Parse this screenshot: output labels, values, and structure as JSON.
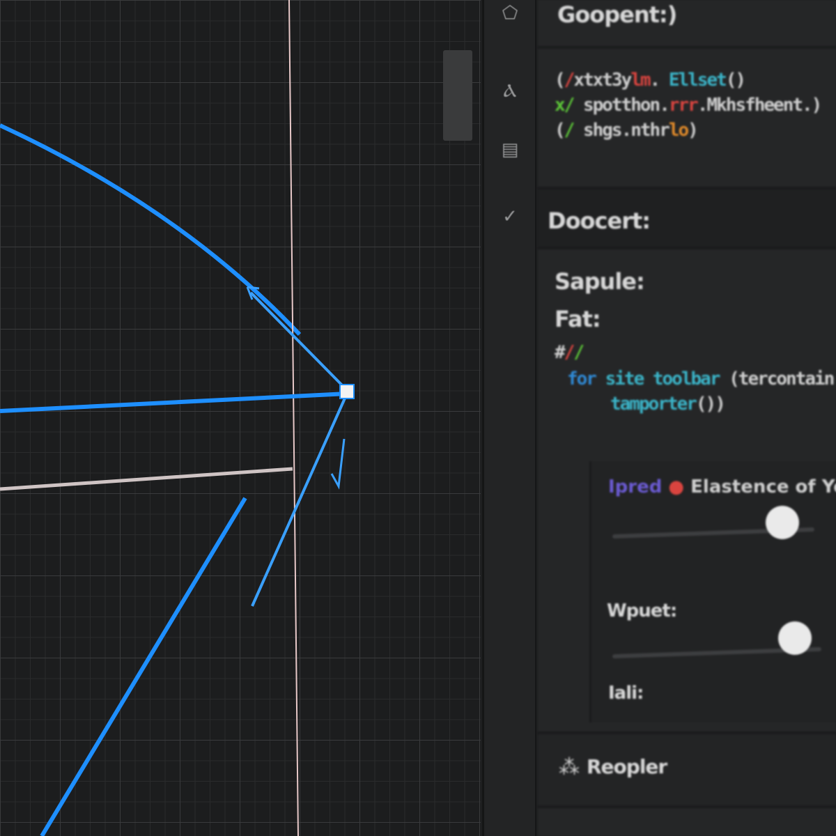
{
  "toolbar": {
    "items": [
      {
        "icon": "tag-icon"
      },
      {
        "icon": "text-tool-icon"
      },
      {
        "icon": "layout-icon"
      },
      {
        "icon": "check-icon"
      }
    ]
  },
  "panel": {
    "header": {
      "title": "Goopent:)"
    },
    "code": {
      "line1": {
        "a": "(",
        "b": "/",
        "c": "xtxt3y",
        "d": "lm",
        ".": ".",
        "e": "Ellset",
        "f": "()"
      },
      "line2": {
        "a": "x/",
        "b": "spotthon.",
        "c": "rrr",
        "d": ".Mkhsfheent.)"
      },
      "line3": {
        "a": "(",
        "b": "/",
        "c": "shgs.nthr",
        "d": "lo",
        "e": ")"
      }
    },
    "document": {
      "title": "Doocert:"
    },
    "props": {
      "sample_label": "Sapule:",
      "fat_label": "Fat:",
      "hash": "#",
      "hash_r": "/",
      "hash_g": "/",
      "code_for": "for",
      "code_a": "site",
      "code_b": "toolbar",
      "code_c": "(tercontain",
      "code_d": "tamporter",
      "code_e": "())"
    },
    "controls": {
      "input_tag": "Ipred",
      "input_text": "Elastence of Yeat",
      "slider1_value": 0.85,
      "wpuet_label": "Wpuet:",
      "slider2_value": 0.88,
      "iali_label": "Iali:"
    },
    "footer": {
      "title": "Reopler"
    }
  },
  "colors": {
    "accent": "#1e90ff",
    "guide": "#e8c9c9"
  }
}
